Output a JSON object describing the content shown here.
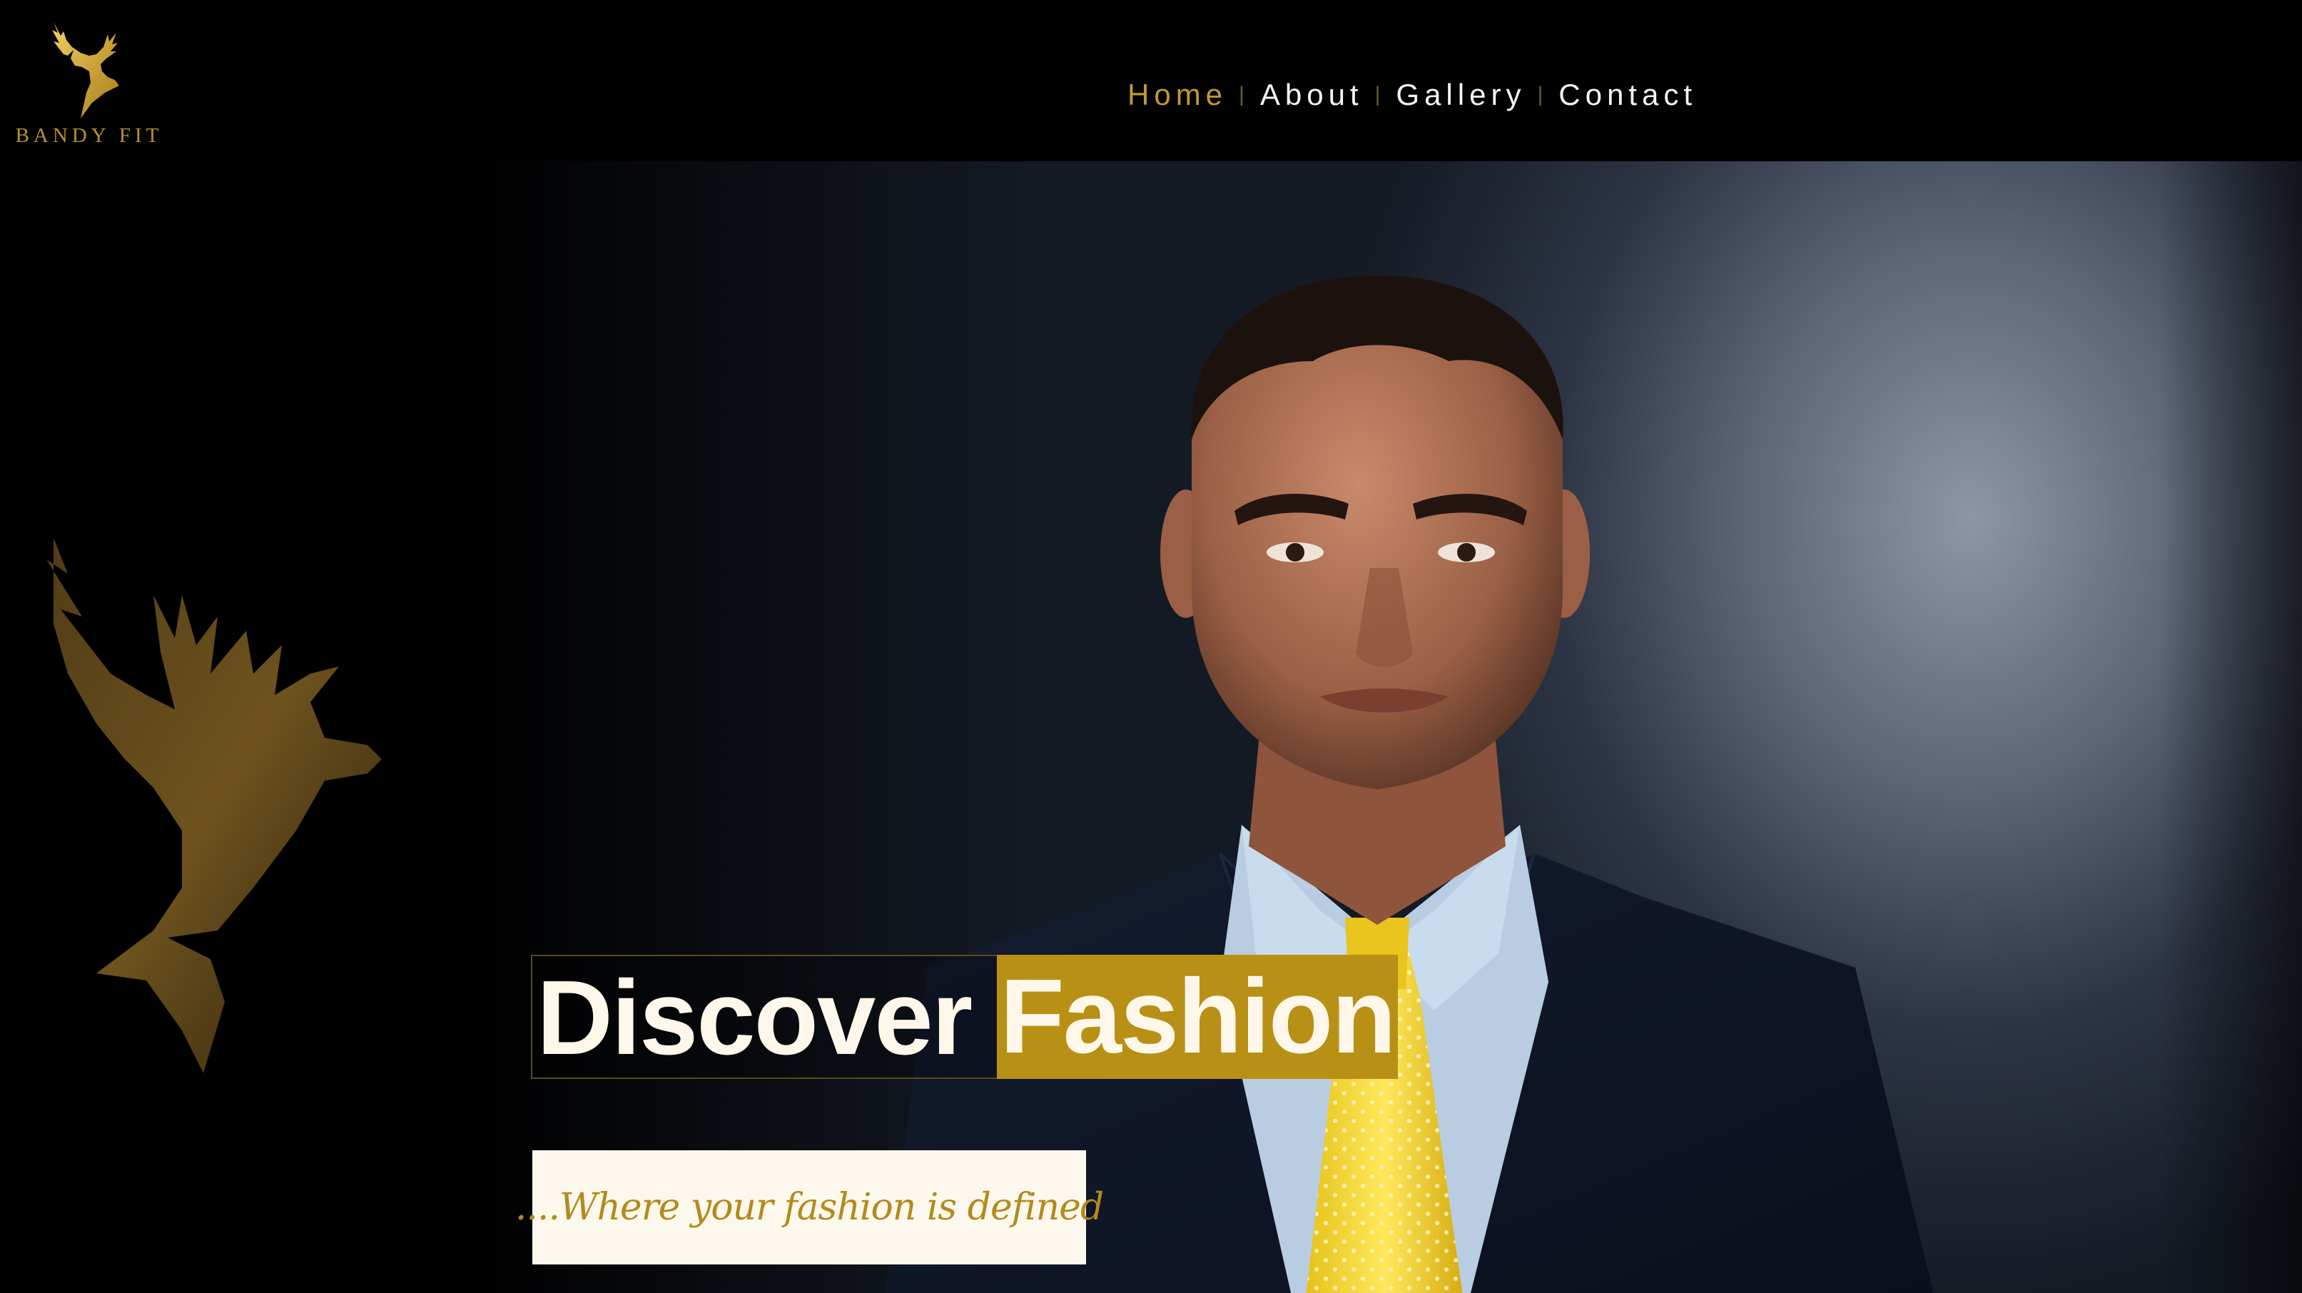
{
  "brand": {
    "name": "BANDY FIT",
    "logo_icon": "stag-head-icon",
    "accent_color": "#c19a2e"
  },
  "nav": {
    "items": [
      {
        "label": "Home",
        "active": true
      },
      {
        "label": "About",
        "active": false
      },
      {
        "label": "Gallery",
        "active": false
      },
      {
        "label": "Contact",
        "active": false
      }
    ],
    "separator": "|"
  },
  "hero": {
    "headline_word_1": "Discover",
    "headline_word_2": "Fashion",
    "tagline": "....Where your fashion is defined",
    "decoration_icon": "stag-head-icon",
    "highlight_color": "#b89015"
  }
}
